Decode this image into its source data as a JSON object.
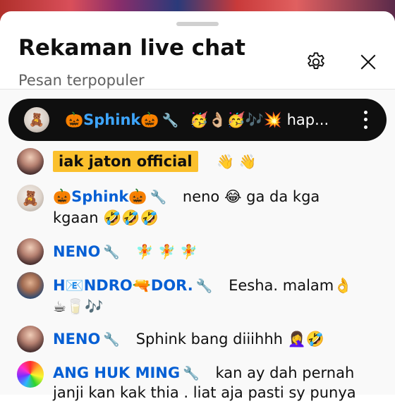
{
  "header": {
    "title": "Rekaman live chat",
    "subtitle": "Pesan terpopuler"
  },
  "ticker": {
    "author": "🎃Sphink🎃",
    "message": "🥳👌🏼🥳🎶💥 hap..."
  },
  "messages": [
    {
      "author": "iak jaton official",
      "text": "👋 👋"
    },
    {
      "author": "🎃Sphink🎃",
      "text": "neno 😂 ga da kga",
      "text2": "kgaan 🤣🤣🤣"
    },
    {
      "author": "NENO",
      "text": "🧚 🧚 🧚"
    },
    {
      "author": "H📧NDRO🔫DOR.",
      "text": "Eesha. malam👌",
      "text2": "☕🥛🎶"
    },
    {
      "author": "NENO",
      "text": "Sphink bang diiihhh 🤦‍♀️🤣"
    },
    {
      "author": "ANG HUK MING",
      "text": "kan ay dah pernah",
      "text2": "janji kan kak thia . liat aja pasti sy punya"
    }
  ],
  "icons": {
    "settings": "gear-icon",
    "close": "close-icon",
    "wrench": "wrench-icon",
    "menu": "more-vert-icon"
  },
  "colors": {
    "author_blue": "#065fd4",
    "ticker_author": "#3ea6ff",
    "highlight": "#fbc02d"
  }
}
